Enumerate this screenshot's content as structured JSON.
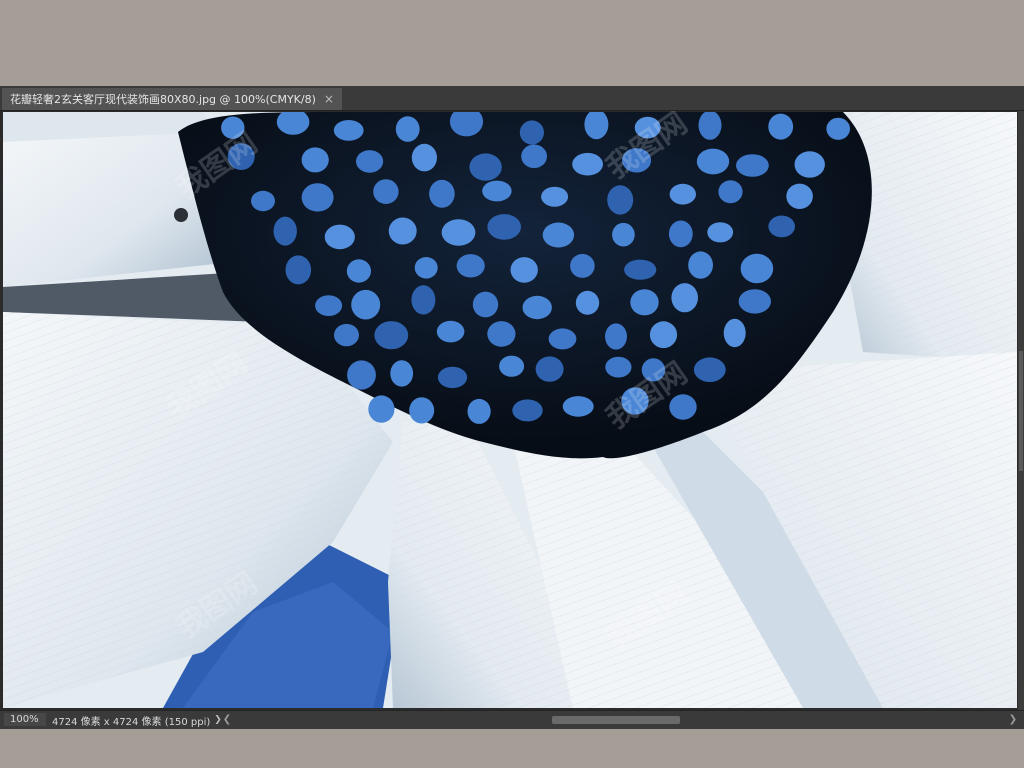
{
  "document": {
    "tab_title": "花瓣轻奢2玄关客厅现代装饰画80X80.jpg @ 100%(CMYK/8)",
    "tab_close_symbol": "×"
  },
  "canvas": {
    "image_subject": "close-up of a white daisy with a dark blue seed center",
    "colors": {
      "petal": "#eef2f5",
      "petal_shadow": "#9fb2c3",
      "center_dark": "#0c1522",
      "seed_blue": "#3f78c9",
      "background_blue": "#2f5fb2"
    }
  },
  "status": {
    "zoom": "100%",
    "doc_info": "4724 像素 x 4724 像素 (150 ppi)",
    "info_arrow": "❯",
    "scroll_left": "❮",
    "scroll_right": "❯"
  },
  "watermark": {
    "text": "我图网"
  }
}
